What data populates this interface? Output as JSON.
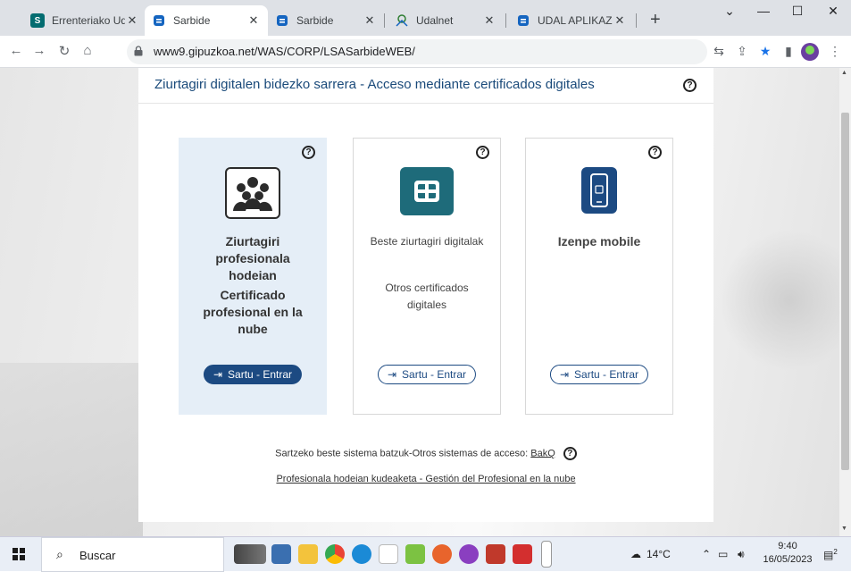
{
  "browser": {
    "tabs": [
      {
        "title": "Errenteriako Ud",
        "favicon": "S",
        "favicon_color": "#036c70"
      },
      {
        "title": "Sarbide",
        "favicon": "shield",
        "favicon_color": "#1565c0",
        "active": true
      },
      {
        "title": "Sarbide",
        "favicon": "shield",
        "favicon_color": "#1565c0"
      },
      {
        "title": "Udalnet",
        "favicon": "udalnet",
        "favicon_color": "#2e7d32"
      },
      {
        "title": "UDAL APLIKAZI",
        "favicon": "shield",
        "favicon_color": "#1565c0"
      }
    ],
    "url": "www9.gipuzkoa.net/WAS/CORP/LSASarbideWEB/"
  },
  "page": {
    "title": "Ziurtagiri digitalen bidezko sarrera - Acceso mediante certificados digitales",
    "help_glyph": "?",
    "cards": [
      {
        "icon": "people-group-icon",
        "icon_bg": "#2b2b2b",
        "text_eu": "Ziurtagiri profesionala hodeian",
        "text_es": "Certificado profesional en la nube",
        "button": "Sartu - Entrar",
        "selected": true
      },
      {
        "icon": "chip-card-icon",
        "icon_bg": "#1e6b7a",
        "text_eu": "Beste ziurtagiri digitalak",
        "text_es": "Otros certificados digitales",
        "button": "Sartu - Entrar",
        "selected": false
      },
      {
        "icon": "mobile-phone-icon",
        "icon_bg": "#1c4a82",
        "text_eu": "Izenpe mobile",
        "text_es": "",
        "button": "Sartu - Entrar",
        "selected": false
      }
    ],
    "other_systems_label": "Sartzeko beste sistema batzuk-Otros sistemas de acceso:",
    "other_systems_link": "BakQ",
    "management_link": "Profesionala hodeian kudeaketa - Gestión del Profesional en la nube"
  },
  "taskbar": {
    "search_placeholder": "Buscar",
    "temperature": "14°C",
    "time": "9:40",
    "date": "16/05/2023",
    "notification_count": "2"
  }
}
